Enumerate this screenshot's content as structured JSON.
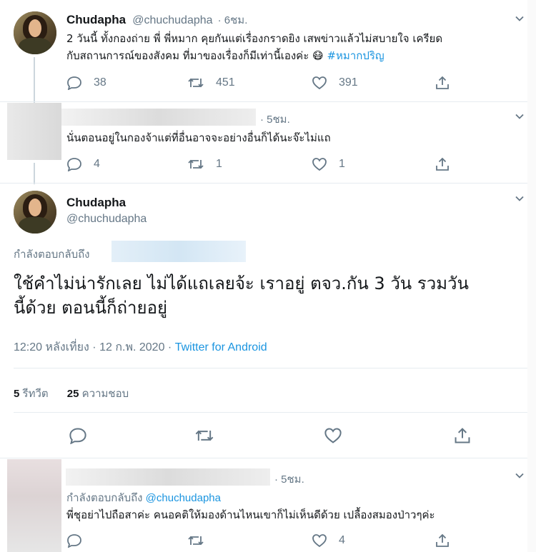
{
  "tweet1": {
    "name": "Chudapha",
    "handle": "@chuchudapha",
    "time": "· 6ชม.",
    "line1": "2 วันนี้ ทั้งกองถ่าย พี่ พี่หมาก คุยกันแต่เรื่องกราดยิง เสพข่าวแล้วไม่สบายใจ เครียด",
    "line2": "กับสถานการณ์ของสังคม ที่มาของเรื่องก็มีเท่านี้เองค่ะ",
    "emoji": "😷",
    "hashtag": "#หมากปริญ",
    "replies": "38",
    "retweets": "451",
    "likes": "391"
  },
  "reply1": {
    "time": "· 5ชม.",
    "text": "นั่นตอนอยู่ในกองจ้าแต่ที่อื่นอาจจะอย่างอื่นก็ได้นะจ๊ะไม่แถ",
    "replies": "4",
    "retweets": "1",
    "likes": "1"
  },
  "main": {
    "name": "Chudapha",
    "handle": "@chuchudapha",
    "replying_prefix": "กำลังตอบกลับถึง",
    "line1": "ใช้คำไม่น่ารักเลย ไม่ได้แถเลยจ้ะ เราอยู่ ตจว.กัน 3 วัน รวมวัน",
    "line2": "นี้ด้วย ตอนนี้ก็ถ่ายอยู่",
    "timestamp": "12:20 หลังเที่ยง · 12 ก.พ. 2020 · ",
    "source": "Twitter for Android",
    "retweet_count": "5",
    "retweet_label": "รีทวีต",
    "like_count": "25",
    "like_label": "ความชอบ"
  },
  "reply2": {
    "time": "· 5ชม.",
    "replying_prefix": "กำลังตอบกลับถึง",
    "replying_handle": "@chuchudapha",
    "text": "พี่ชุอย่าไปถือสาค่ะ คนอคติให้มองด้านไหนเขาก็ไม่เห็นดีด้วย เปลื้องสมองป่าวๆค่ะ",
    "likes": "4"
  },
  "colors": {
    "text": "#14171a",
    "secondary": "#657786",
    "link": "#1b95e0",
    "divider": "#e6ecf0",
    "thread_line": "#ccd6dd"
  }
}
